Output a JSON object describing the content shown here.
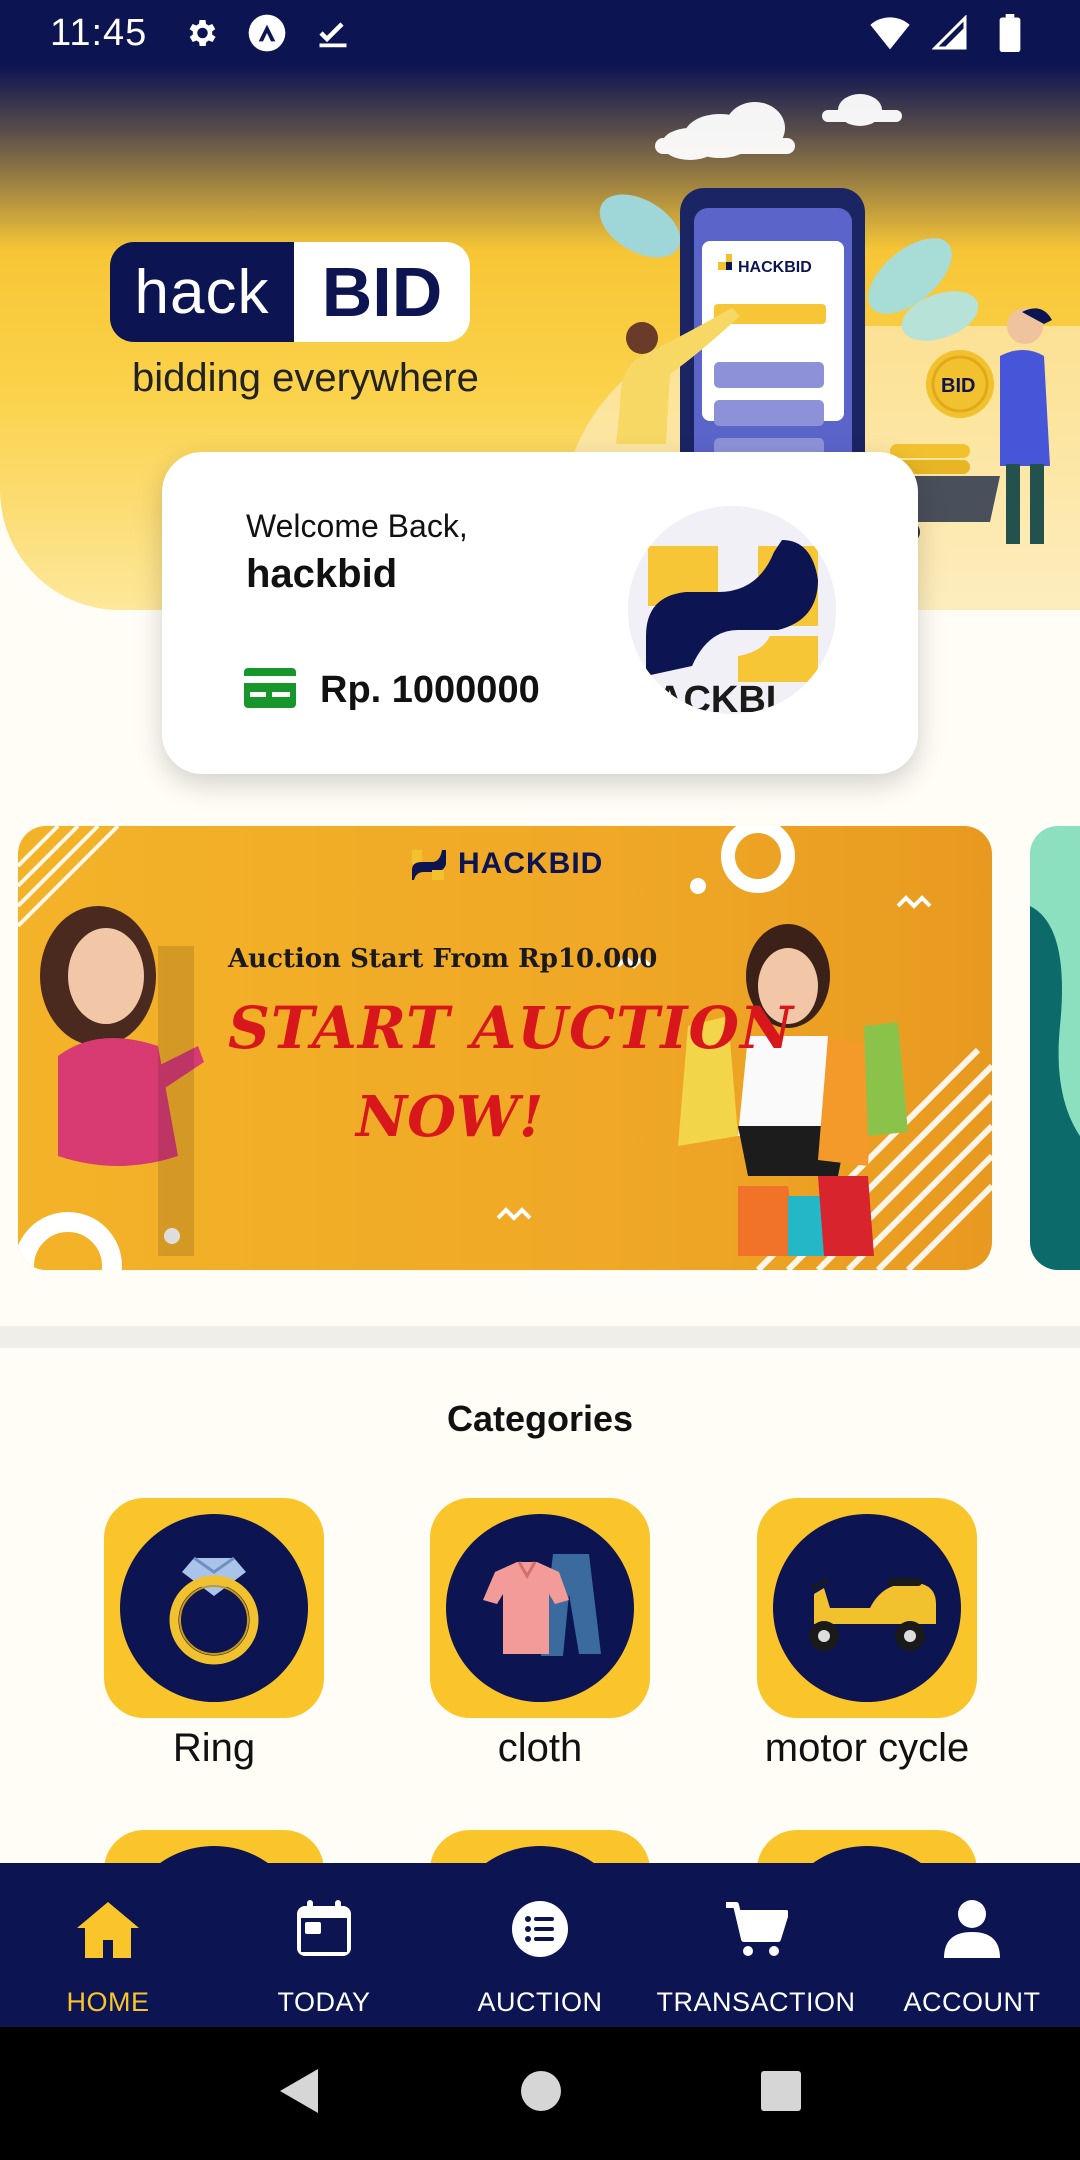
{
  "status_bar": {
    "time": "11:45",
    "left_icons": [
      "gear-icon",
      "a-logo-icon",
      "check-icon"
    ],
    "right_icons": [
      "wifi-icon",
      "signal-icon",
      "battery-icon"
    ]
  },
  "hero": {
    "logo_left": "hack",
    "logo_right": "BID",
    "tagline": "bidding everywhere",
    "illustration_badge": "BID",
    "illustration_brand": "HACKBID"
  },
  "welcome_card": {
    "greeting": "Welcome Back,",
    "username": "hackbid",
    "balance_icon": "credit-card-icon",
    "balance": "Rp. 1000000"
  },
  "banner": {
    "brand": "HACKBID",
    "subtitle": "Auction Start From Rp10.000",
    "title": "START AUCTION",
    "title_line2": "NOW!"
  },
  "categories": {
    "title": "Categories",
    "items": [
      {
        "label": "Ring",
        "icon": "ring-icon"
      },
      {
        "label": "cloth",
        "icon": "cloth-icon"
      },
      {
        "label": "motor cycle",
        "icon": "motorcycle-icon"
      }
    ]
  },
  "bottom_nav": {
    "items": [
      {
        "label": "HOME",
        "icon": "home-icon",
        "active": true
      },
      {
        "label": "TODAY",
        "icon": "calendar-icon",
        "active": false
      },
      {
        "label": "AUCTION",
        "icon": "list-icon",
        "active": false
      },
      {
        "label": "TRANSACTION",
        "icon": "cart-icon",
        "active": false
      },
      {
        "label": "ACCOUNT",
        "icon": "person-icon",
        "active": false
      }
    ]
  },
  "colors": {
    "navy": "#0d1452",
    "yellow": "#f9c52a",
    "active_nav": "#f9c52a"
  }
}
